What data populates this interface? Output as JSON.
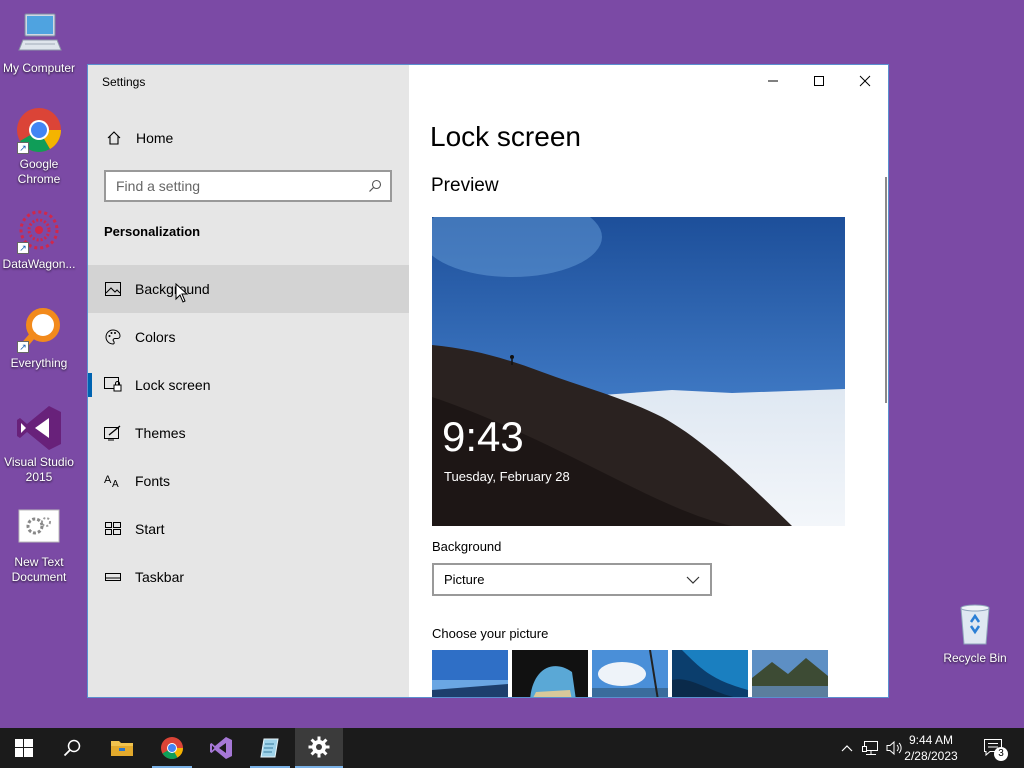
{
  "desktop": {
    "icons": [
      {
        "label": "My Computer",
        "icon": "computer-icon"
      },
      {
        "label": "Google Chrome",
        "icon": "chrome-icon"
      },
      {
        "label": "DataWagon...",
        "icon": "datawagon-icon"
      },
      {
        "label": "Everything",
        "icon": "everything-search-icon"
      },
      {
        "label": "Visual Studio 2015",
        "icon": "visual-studio-icon"
      },
      {
        "label": "New Text Document",
        "icon": "text-document-icon"
      },
      {
        "label": "Recycle Bin",
        "icon": "recycle-bin-icon"
      }
    ],
    "background_color": "#7b4aa5"
  },
  "window": {
    "app_title": "Settings",
    "controls": {
      "minimize": "minimize-icon",
      "maximize": "maximize-icon",
      "close": "close-icon"
    }
  },
  "sidebar": {
    "home_label": "Home",
    "search": {
      "placeholder": "Find a setting"
    },
    "section_heading": "Personalization",
    "items": [
      {
        "label": "Background",
        "icon": "image-icon",
        "state": "hover"
      },
      {
        "label": "Colors",
        "icon": "palette-icon"
      },
      {
        "label": "Lock screen",
        "icon": "lock-screen-icon",
        "state": "selected"
      },
      {
        "label": "Themes",
        "icon": "themes-icon"
      },
      {
        "label": "Fonts",
        "icon": "fonts-icon"
      },
      {
        "label": "Start",
        "icon": "start-icon"
      },
      {
        "label": "Taskbar",
        "icon": "taskbar-icon"
      }
    ]
  },
  "main": {
    "title": "Lock screen",
    "preview_heading": "Preview",
    "preview_time": "9:43",
    "preview_date": "Tuesday, February 28",
    "background_label": "Background",
    "background_value": "Picture",
    "choose_label": "Choose your picture"
  },
  "taskbar": {
    "apps": [
      "start-button",
      "search-button",
      "file-explorer",
      "google-chrome",
      "visual-studio",
      "notepad-app",
      "settings-app"
    ],
    "clock_time": "9:44 AM",
    "clock_date": "2/28/2023",
    "notification_count": "3",
    "accent": "#7ab1e6"
  }
}
